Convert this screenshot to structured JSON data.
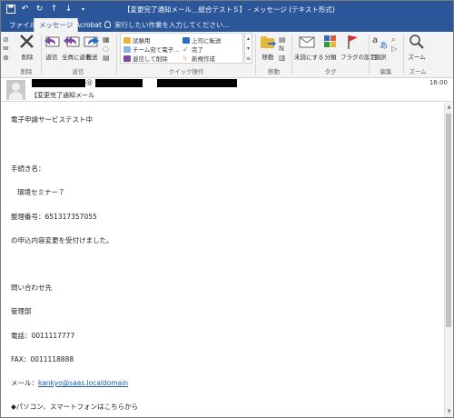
{
  "window": {
    "title": "【変更完了通知メール＿総合テスト５】 - メッセージ (テキスト形式)"
  },
  "tabs": {
    "file": "ファイル",
    "message": "メッセージ",
    "acrobat": "Acrobat",
    "tell_me": "実行したい作業を入力してください..."
  },
  "ribbon": {
    "groups": {
      "delete": "削除",
      "respond": "返信",
      "quick_steps": "クイック操作",
      "move": "移動",
      "tags": "タグ",
      "editing": "編集",
      "zoom": "ズーム"
    },
    "buttons": {
      "delete": "削除",
      "reply": "返信",
      "reply_all": "全員に返信",
      "forward": "転送",
      "move": "移動",
      "mark_unread": "未読にする",
      "categorize": "分類",
      "follow_up": "フラグの設定",
      "translate": "翻訳",
      "zoom": "ズーム"
    },
    "quick_steps": [
      "試験用",
      "上司に転送",
      "チーム宛て電子...",
      "完了",
      "返信して削除",
      "新規作成"
    ]
  },
  "header": {
    "from_at": "@",
    "subject": "【変更完了通知メール",
    "time": "16:00"
  },
  "body": {
    "lines": [
      "電子申請サービステスト中",
      "手続き名：",
      "環境セミナー７",
      "整理番号：651317357055",
      "の申込内容変更を受付けました。",
      "問い合わせ先",
      "管理部",
      "電話：0011117777",
      "FAX：0011118888",
      "メール：",
      "◆パソコン、スマートフォンはこちらから"
    ],
    "email_link": "kankyo@saas.localdomain"
  },
  "colors": {
    "title_bar": "#2b579a",
    "ribbon": "#f3f3f3",
    "link": "#1a58b5"
  }
}
